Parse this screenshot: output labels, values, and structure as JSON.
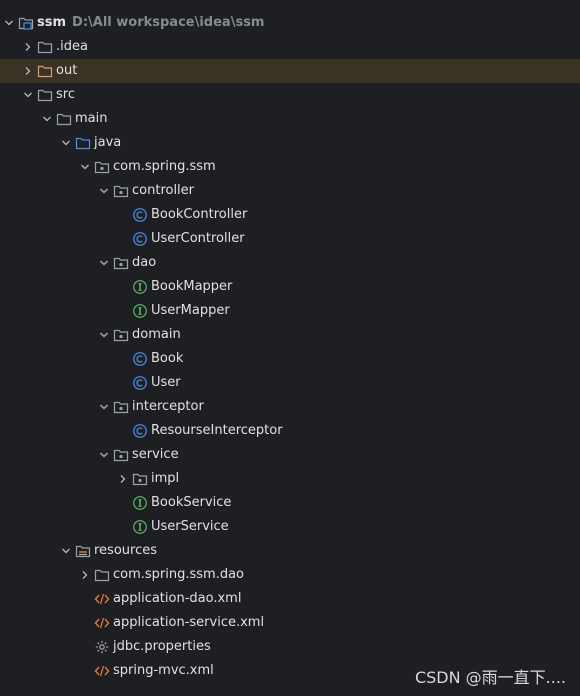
{
  "project": {
    "name": "ssm",
    "path": "D:\\All workspace\\idea\\ssm"
  },
  "tree": [
    {
      "label": "ssm",
      "path": "D:\\All workspace\\idea\\ssm",
      "depth": 0,
      "expanded": true,
      "icon": "project-folder-icon",
      "kind": "project"
    },
    {
      "label": ".idea",
      "depth": 1,
      "expanded": false,
      "icon": "folder-icon",
      "kind": "folder"
    },
    {
      "label": "out",
      "depth": 1,
      "expanded": false,
      "icon": "excluded-folder-icon",
      "kind": "folder",
      "selected": true
    },
    {
      "label": "src",
      "depth": 1,
      "expanded": true,
      "icon": "folder-icon",
      "kind": "folder"
    },
    {
      "label": "main",
      "depth": 2,
      "expanded": true,
      "icon": "folder-icon",
      "kind": "folder"
    },
    {
      "label": "java",
      "depth": 3,
      "expanded": true,
      "icon": "source-folder-icon",
      "kind": "folder"
    },
    {
      "label": "com.spring.ssm",
      "depth": 4,
      "expanded": true,
      "icon": "package-icon",
      "kind": "package"
    },
    {
      "label": "controller",
      "depth": 5,
      "expanded": true,
      "icon": "package-icon",
      "kind": "package"
    },
    {
      "label": "BookController",
      "depth": 6,
      "icon": "class-icon",
      "kind": "class"
    },
    {
      "label": "UserController",
      "depth": 6,
      "icon": "class-icon",
      "kind": "class"
    },
    {
      "label": "dao",
      "depth": 5,
      "expanded": true,
      "icon": "package-icon",
      "kind": "package"
    },
    {
      "label": "BookMapper",
      "depth": 6,
      "icon": "interface-icon",
      "kind": "interface"
    },
    {
      "label": "UserMapper",
      "depth": 6,
      "icon": "interface-icon",
      "kind": "interface"
    },
    {
      "label": "domain",
      "depth": 5,
      "expanded": true,
      "icon": "package-icon",
      "kind": "package"
    },
    {
      "label": "Book",
      "depth": 6,
      "icon": "class-icon",
      "kind": "class"
    },
    {
      "label": "User",
      "depth": 6,
      "icon": "class-icon",
      "kind": "class"
    },
    {
      "label": "interceptor",
      "depth": 5,
      "expanded": true,
      "icon": "package-icon",
      "kind": "package"
    },
    {
      "label": "ResourseInterceptor",
      "depth": 6,
      "icon": "class-icon",
      "kind": "class"
    },
    {
      "label": "service",
      "depth": 5,
      "expanded": true,
      "icon": "package-icon",
      "kind": "package"
    },
    {
      "label": "impl",
      "depth": 6,
      "expanded": false,
      "icon": "package-icon",
      "kind": "package"
    },
    {
      "label": "BookService",
      "depth": 6,
      "icon": "interface-icon",
      "kind": "interface"
    },
    {
      "label": "UserService",
      "depth": 6,
      "icon": "interface-icon",
      "kind": "interface"
    },
    {
      "label": "resources",
      "depth": 3,
      "expanded": true,
      "icon": "resources-folder-icon",
      "kind": "folder"
    },
    {
      "label": "com.spring.ssm.dao",
      "depth": 4,
      "expanded": false,
      "icon": "folder-icon",
      "kind": "folder"
    },
    {
      "label": "application-dao.xml",
      "depth": 4,
      "icon": "xml-file-icon",
      "kind": "file"
    },
    {
      "label": "application-service.xml",
      "depth": 4,
      "icon": "xml-file-icon",
      "kind": "file"
    },
    {
      "label": "jdbc.properties",
      "depth": 4,
      "icon": "properties-file-icon",
      "kind": "file"
    },
    {
      "label": "spring-mvc.xml",
      "depth": 4,
      "icon": "xml-file-icon",
      "kind": "file"
    }
  ],
  "watermark": "CSDN @雨一直下....",
  "colors": {
    "background": "#1e1f22",
    "selected_row": "#3b3226",
    "text": "#dfe1e5",
    "path_text": "#868a91",
    "class_icon": "#4c8fe8",
    "interface_icon": "#5fb865",
    "xml_icon": "#e07a3a",
    "excluded_folder": "#d6a26a",
    "source_folder": "#4c8fe8"
  }
}
